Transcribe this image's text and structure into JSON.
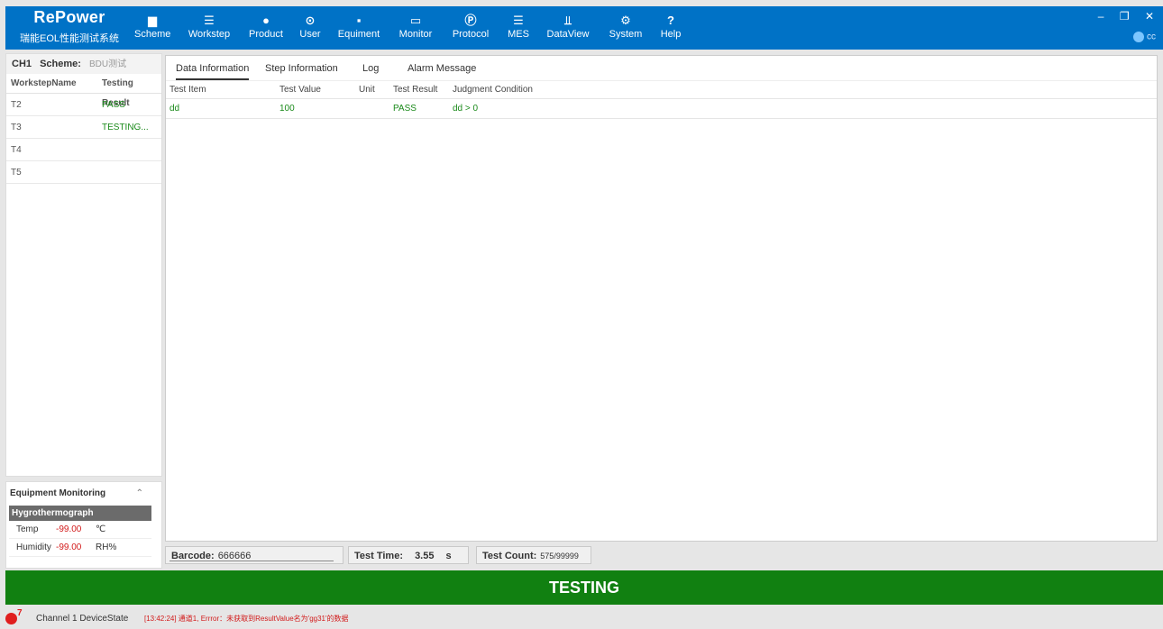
{
  "app": {
    "name": "RePower",
    "subtitle": "瑞能EOL性能测试系统"
  },
  "nav": [
    {
      "label": "Scheme",
      "icon": "scheme-icon",
      "glyph": "▆"
    },
    {
      "label": "Workstep",
      "icon": "workstep-icon",
      "glyph": "☰"
    },
    {
      "label": "Product",
      "icon": "product-icon",
      "glyph": "●"
    },
    {
      "label": "User",
      "icon": "user-icon",
      "glyph": "⊙"
    },
    {
      "label": "Equiment",
      "icon": "equipment-icon",
      "glyph": "▪"
    },
    {
      "label": "Monitor",
      "icon": "monitor-icon",
      "glyph": "▭"
    },
    {
      "label": "Protocol",
      "icon": "protocol-icon",
      "glyph": "Ⓟ"
    },
    {
      "label": "MES",
      "icon": "mes-icon",
      "glyph": "☰"
    },
    {
      "label": "DataView",
      "icon": "dataview-icon",
      "glyph": "⫫"
    },
    {
      "label": "System",
      "icon": "system-icon",
      "glyph": "⚙"
    },
    {
      "label": "Help",
      "icon": "help-icon",
      "glyph": "?"
    }
  ],
  "window": {
    "minimize": "‒",
    "restore": "❐",
    "close": "✕"
  },
  "user": {
    "name": "cc"
  },
  "left": {
    "channel": "CH1",
    "scheme_label": "Scheme:",
    "scheme_value": "BDU测试",
    "col_name": "WorkstepName",
    "col_result": "Testing Result",
    "rows": [
      {
        "name": "T2",
        "result": "PASS"
      },
      {
        "name": "T3",
        "result": "TESTING..."
      },
      {
        "name": "T4",
        "result": ""
      },
      {
        "name": "T5",
        "result": ""
      }
    ]
  },
  "equipment": {
    "title": "Equipment Monitoring",
    "chevron": "⌃",
    "device": "Hygrothermograph",
    "rows": [
      {
        "label": "Temp",
        "value": "-99.00",
        "unit": "℃"
      },
      {
        "label": "Humidity",
        "value": "-99.00",
        "unit": "RH%"
      }
    ]
  },
  "main": {
    "tabs": [
      "Data Information",
      "Step Information",
      "Log",
      "Alarm Message"
    ],
    "columns": [
      "Test Item",
      "Test Value",
      "Unit",
      "Test Result",
      "Judgment Condition"
    ],
    "rows": [
      {
        "item": "dd",
        "value": "100",
        "unit": "",
        "result": "PASS",
        "condition": "dd > 0"
      }
    ]
  },
  "info": {
    "barcode_label": "Barcode:",
    "barcode_value": "666666",
    "time_label": "Test Time:",
    "time_value": "3.55",
    "time_unit": "s",
    "count_label": "Test Count:",
    "count_value": "575/99999"
  },
  "status": {
    "text": "TESTING"
  },
  "footer": {
    "alert_count": "7",
    "device_state": "Channel 1 DeviceState",
    "message": "[13:42:24] 通道1, Errror：未获取到ResultValue名为'gg31'的数据"
  }
}
